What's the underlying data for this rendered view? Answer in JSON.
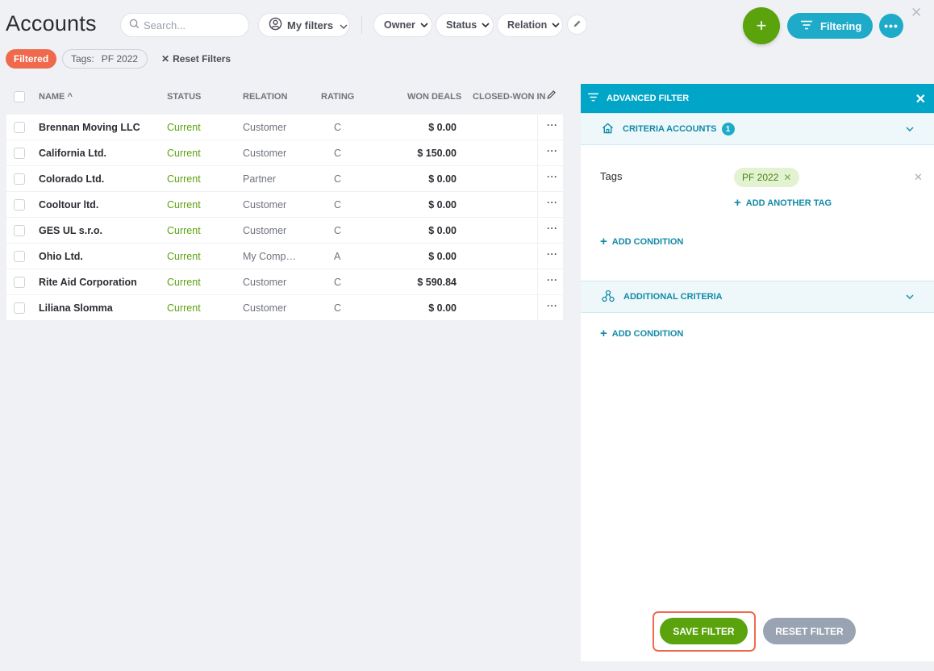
{
  "header": {
    "title": "Accounts",
    "search_placeholder": "Search...",
    "my_filters": "My filters",
    "dropdowns": [
      "Owner",
      "Status",
      "Relation"
    ],
    "add_label": "+",
    "filtering_label": "Filtering",
    "more_label": "•••"
  },
  "filter_bar": {
    "filtered_badge": "Filtered",
    "tag_chip_label": "Tags:",
    "tag_chip_value": "PF 2022",
    "reset_filters": "Reset Filters"
  },
  "table": {
    "columns": [
      "NAME",
      "STATUS",
      "RELATION",
      "RATING",
      "WON DEALS",
      "CLOSED-WON IN"
    ],
    "rows": [
      {
        "name": "Brennan Moving LLC",
        "status": "Current",
        "relation": "Customer",
        "rating": "C",
        "won": "$ 0.00"
      },
      {
        "name": "California Ltd.",
        "status": "Current",
        "relation": "Customer",
        "rating": "C",
        "won": "$ 150.00"
      },
      {
        "name": "Colorado Ltd.",
        "status": "Current",
        "relation": "Partner",
        "rating": "C",
        "won": "$ 0.00"
      },
      {
        "name": "Cooltour ltd.",
        "status": "Current",
        "relation": "Customer",
        "rating": "C",
        "won": "$ 0.00"
      },
      {
        "name": "GES UL s.r.o.",
        "status": "Current",
        "relation": "Customer",
        "rating": "C",
        "won": "$ 0.00"
      },
      {
        "name": "Ohio Ltd.",
        "status": "Current",
        "relation": "My Comp…",
        "rating": "A",
        "won": "$ 0.00"
      },
      {
        "name": "Rite Aid Corporation",
        "status": "Current",
        "relation": "Customer",
        "rating": "C",
        "won": "$ 590.84"
      },
      {
        "name": "Liliana Slomma",
        "status": "Current",
        "relation": "Customer",
        "rating": "C",
        "won": "$ 0.00"
      }
    ],
    "row_more": "···"
  },
  "panel": {
    "title": "ADVANCED FILTER",
    "criteria_label": "CRITERIA ACCOUNTS",
    "criteria_count": "1",
    "tags_label": "Tags",
    "tag_value": "PF 2022",
    "add_another_tag": "ADD ANOTHER TAG",
    "add_condition": "ADD CONDITION",
    "additional_label": "ADDITIONAL CRITERIA",
    "save_filter": "SAVE FILTER",
    "reset_filter": "RESET FILTER"
  },
  "colors": {
    "accent": "#1eaac9",
    "green": "#5aa30d",
    "orange": "#ef6a4d"
  }
}
